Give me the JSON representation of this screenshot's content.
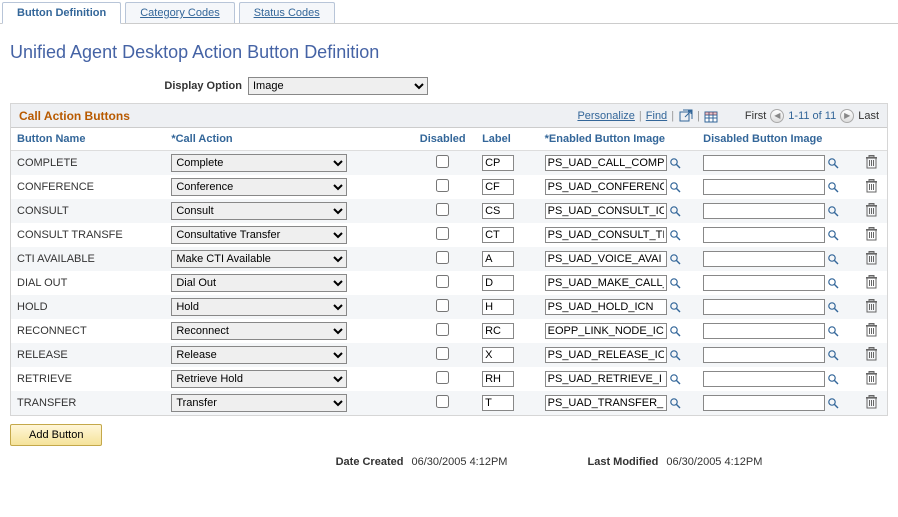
{
  "tabs": [
    {
      "label": "Button Definition",
      "active": true
    },
    {
      "label": "Category Codes",
      "active": false,
      "accel": "C"
    },
    {
      "label": "Status Codes",
      "active": false,
      "accel": "S"
    }
  ],
  "page_title": "Unified Agent Desktop Action Button Definition",
  "display_option": {
    "label": "Display Option",
    "value": "Image"
  },
  "grid": {
    "title": "Call Action Buttons",
    "links": {
      "personalize": "Personalize",
      "find": "Find"
    },
    "nav": {
      "first": "First",
      "range": "1-11 of 11",
      "last": "Last"
    }
  },
  "headers": {
    "button_name": "Button Name",
    "call_action": "*Call Action",
    "disabled": "Disabled",
    "label": "Label",
    "enabled_image": "*Enabled Button Image",
    "disabled_image": "Disabled Button Image"
  },
  "rows": [
    {
      "name": "COMPLETE",
      "action": "Complete",
      "disabled": false,
      "label": "CP",
      "enabled": "PS_UAD_CALL_COMPL",
      "disabled_img": ""
    },
    {
      "name": "CONFERENCE",
      "action": "Conference",
      "disabled": false,
      "label": "CF",
      "enabled": "PS_UAD_CONFERENC",
      "disabled_img": ""
    },
    {
      "name": "CONSULT",
      "action": "Consult",
      "disabled": false,
      "label": "CS",
      "enabled": "PS_UAD_CONSULT_IC",
      "disabled_img": ""
    },
    {
      "name": "CONSULT TRANSFE",
      "action": "Consultative Transfer",
      "disabled": false,
      "label": "CT",
      "enabled": "PS_UAD_CONSULT_TI",
      "disabled_img": ""
    },
    {
      "name": "CTI AVAILABLE",
      "action": "Make CTI Available",
      "disabled": false,
      "label": "A",
      "enabled": "PS_UAD_VOICE_AVAI",
      "disabled_img": ""
    },
    {
      "name": "DIAL OUT",
      "action": "Dial Out",
      "disabled": false,
      "label": "D",
      "enabled": "PS_UAD_MAKE_CALL_",
      "disabled_img": ""
    },
    {
      "name": "HOLD",
      "action": "Hold",
      "disabled": false,
      "label": "H",
      "enabled": "PS_UAD_HOLD_ICN",
      "disabled_img": ""
    },
    {
      "name": "RECONNECT",
      "action": "Reconnect",
      "disabled": false,
      "label": "RC",
      "enabled": "EOPP_LINK_NODE_IC",
      "disabled_img": ""
    },
    {
      "name": "RELEASE",
      "action": "Release",
      "disabled": false,
      "label": "X",
      "enabled": "PS_UAD_RELEASE_IC",
      "disabled_img": ""
    },
    {
      "name": "RETRIEVE",
      "action": "Retrieve Hold",
      "disabled": false,
      "label": "RH",
      "enabled": "PS_UAD_RETRIEVE_I",
      "disabled_img": ""
    },
    {
      "name": "TRANSFER",
      "action": "Transfer",
      "disabled": false,
      "label": "T",
      "enabled": "PS_UAD_TRANSFER_I",
      "disabled_img": ""
    }
  ],
  "add_button": "Add Button",
  "footer": {
    "created_label": "Date Created",
    "created_value": "06/30/2005  4:12PM",
    "modified_label": "Last Modified",
    "modified_value": "06/30/2005  4:12PM"
  }
}
